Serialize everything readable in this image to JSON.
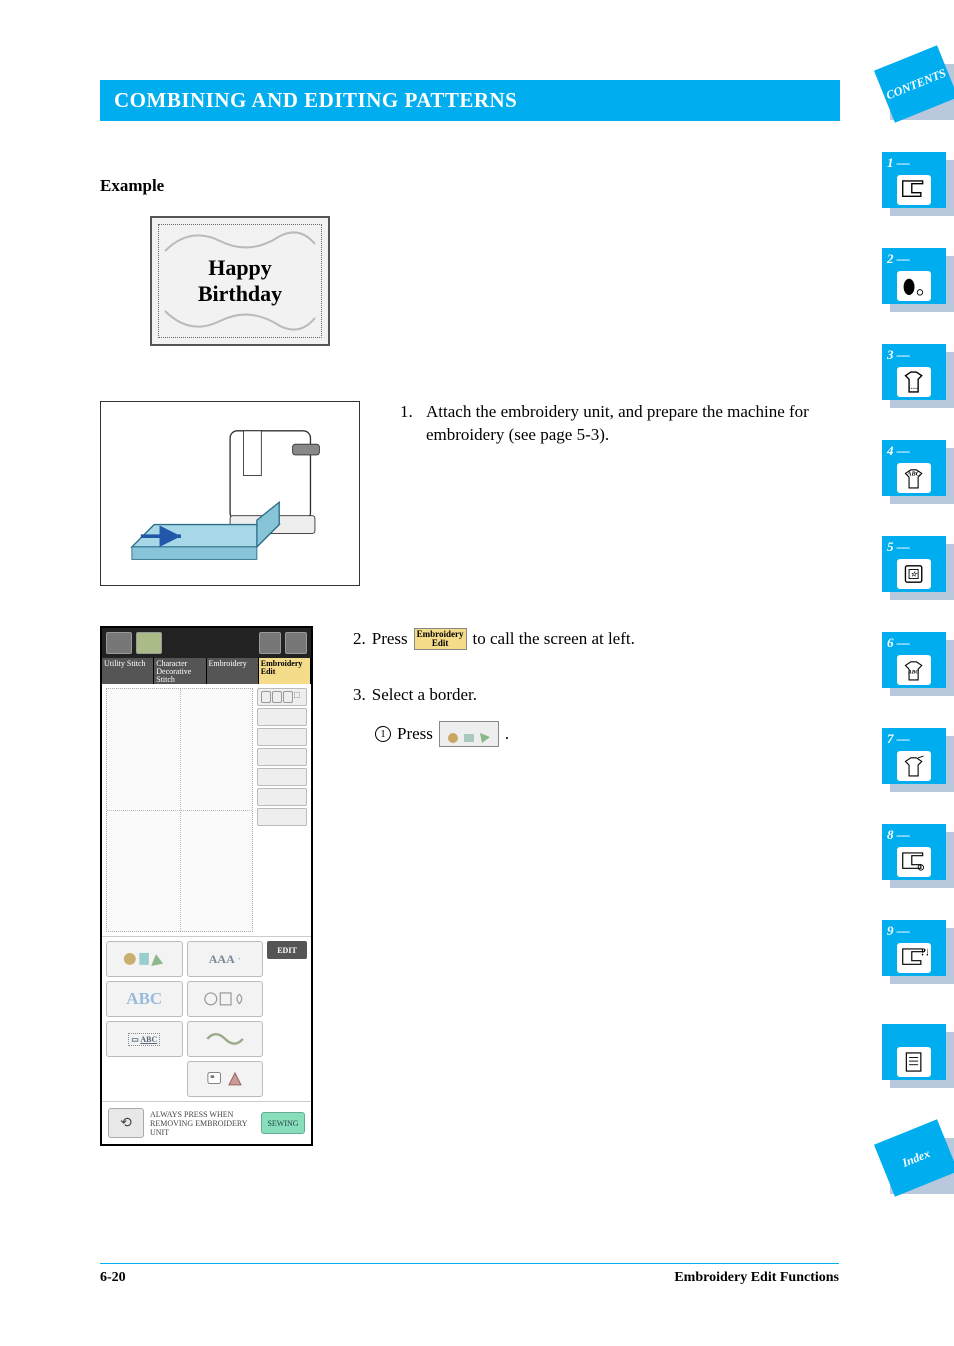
{
  "heading": "COMBINING AND EDITING PATTERNS",
  "example_label": "Example",
  "happy_line1": "Happy",
  "happy_line2": "Birthday",
  "step1": {
    "num": "1.",
    "text": "Attach the embroidery unit, and prepare the machine for embroidery (see page 5-3)."
  },
  "step2": {
    "num": "2.",
    "before": "Press",
    "btn_line1": "Embroidery",
    "btn_line2": "Edit",
    "after": "to call the screen at left."
  },
  "step3": {
    "num": "3.",
    "text": "Select a border.",
    "sub_num": "1",
    "sub_text": "Press",
    "sub_after": "."
  },
  "lcd": {
    "tab1": "Utility Stitch",
    "tab2": "Character Decorative Stitch",
    "tab3": "Embroidery",
    "tab4": "Embroidery Edit",
    "pal_abc_outline": "ABC",
    "pal_abc_small": "ABC",
    "pal_aaa": "AAA",
    "edit_label": "EDIT",
    "footer_text": "ALWAYS PRESS WHEN REMOVING EMBROIDERY UNIT",
    "sewing": "SEWING"
  },
  "footer": {
    "page": "6-20",
    "title": "Embroidery Edit Functions"
  },
  "tabs": {
    "contents": "CONTENTS",
    "t1": "1 —",
    "t2": "2 —",
    "t3": "3 —",
    "t4": "4 —",
    "t5": "5 —",
    "t6": "6 —",
    "t7": "7 —",
    "t8": "8 —",
    "t9": "9 —",
    "index": "Index"
  }
}
